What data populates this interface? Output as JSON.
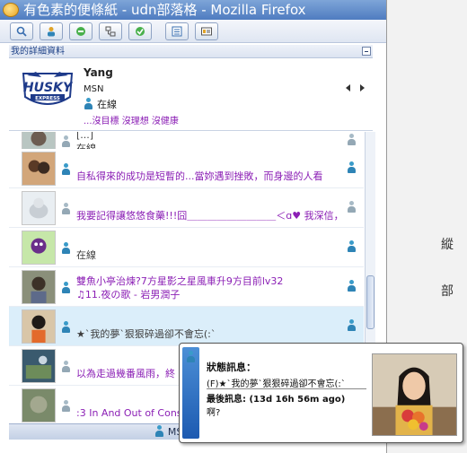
{
  "window": {
    "title": "有色素的便條紙 - udn部落格 - Mozilla Firefox"
  },
  "toolbar": {
    "buttons": [
      {
        "icon": "search-icon"
      },
      {
        "icon": "add-contact-icon"
      },
      {
        "icon": "status-icon"
      },
      {
        "icon": "network-icon"
      },
      {
        "icon": "check-icon"
      },
      {
        "icon": "list-icon"
      },
      {
        "icon": "card-icon"
      }
    ]
  },
  "profile_section": {
    "header": "我的詳細資料"
  },
  "profile": {
    "name": "Yang",
    "service": "MSN",
    "status": "在線",
    "personal_message": "...沒目標 沒理想  沒健康",
    "logo_text": "HUSKY",
    "logo_subtext": "EXPRESS"
  },
  "contacts": [
    {
      "line1": "[...]",
      "line2": "在線",
      "color": "gray",
      "style": "plain"
    },
    {
      "line1": "",
      "line2": "自私得來的成功是短暫的...當妳遇到挫敗，而身邊的人看",
      "color": "blue",
      "style": "purple"
    },
    {
      "line1": "",
      "line2": "我要記得讓悠悠食藥!!!囧＿＿＿＿＿＿＿＿＿＜ɑ♥ 我深信，",
      "color": "gray",
      "style": "purple"
    },
    {
      "line1": "",
      "line2": "在線",
      "color": "blue",
      "style": "plain"
    },
    {
      "line1": "雙魚小亭治煉?7方星影之星風車升9方目前lv32",
      "line2": "♫11.夜の歌 - 岩男潤子",
      "color": "blue",
      "style": "purple"
    },
    {
      "line1": "",
      "line2": "★`我的夢`狠狠碎過卻不會忘(:`",
      "color": "blue",
      "style": "plain"
    },
    {
      "line1": "",
      "line2": "以為走過幾番風雨，終",
      "color": "gray",
      "style": "purple"
    },
    {
      "line1": "",
      "line2": ":3 In And Out of Conscio",
      "color": "gray",
      "style": "purple"
    }
  ],
  "statusbar": {
    "text": "MSN [0] 在線"
  },
  "tooltip": {
    "status_label": "狀態訊息：",
    "status_value": "(F)★`我的夢`狠狠碎過卻不會忘(:`",
    "last_label": "最後訊息: (13d 16h 56m ago)",
    "last_value": "啊?"
  },
  "background_window": {
    "chars": "縱\n\n部"
  },
  "colors": {
    "accent": "#2e84b6",
    "psm_purple": "#8b1fb5",
    "selected_row": "#dbeefa"
  }
}
